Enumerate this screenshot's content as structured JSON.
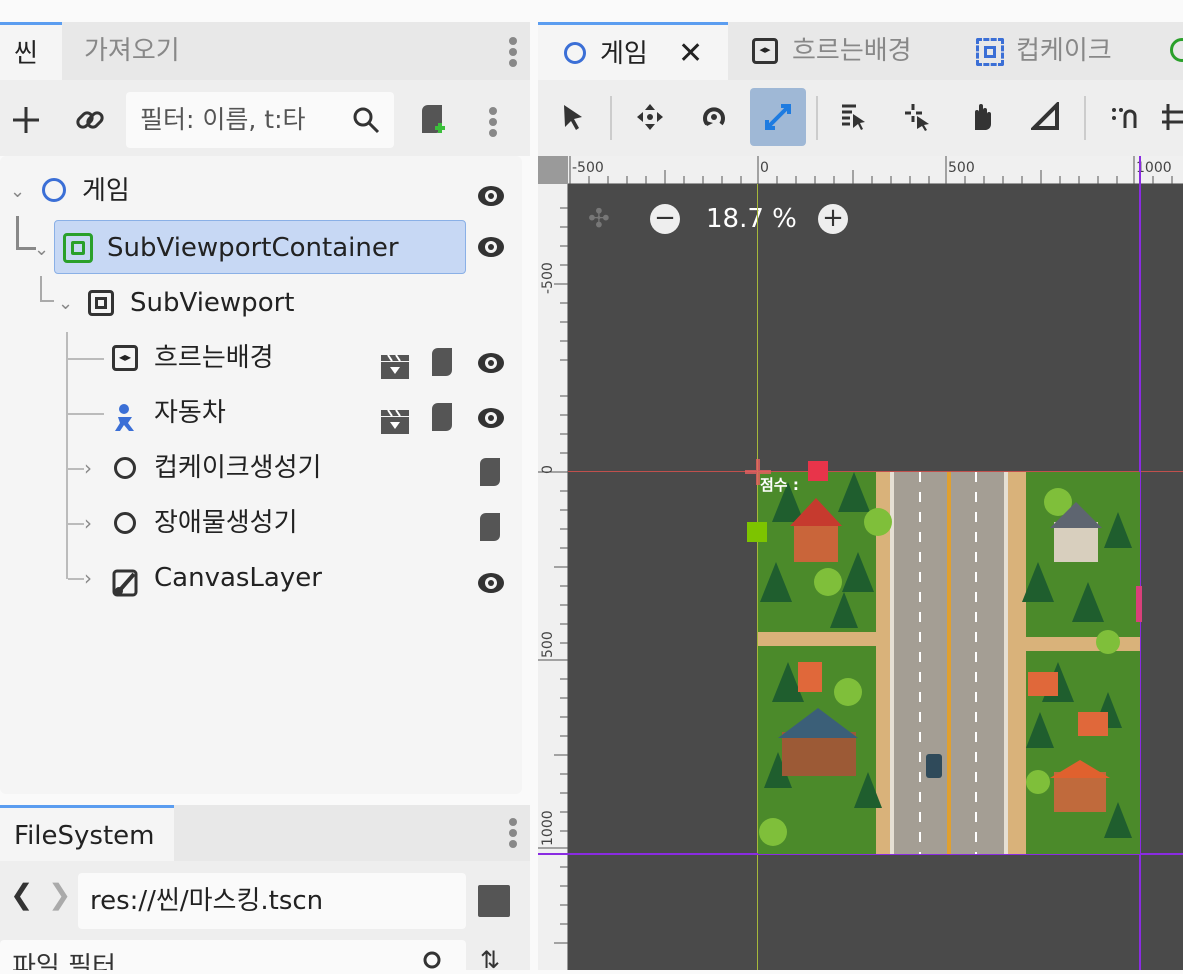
{
  "scene_dock": {
    "tabs": [
      "씬",
      "가져오기"
    ],
    "filter_placeholder": "필터: 이름, t:타",
    "tree": [
      {
        "label": "게임",
        "icon": "node-circle-icon",
        "visible": true
      },
      {
        "label": "SubViewportContainer",
        "icon": "subviewport-container-icon",
        "visible": true,
        "selected": true
      },
      {
        "label": "SubViewport",
        "icon": "subviewport-icon"
      },
      {
        "label": "흐르는배경",
        "icon": "parallax-icon",
        "visible": true,
        "script": true,
        "clapper": true
      },
      {
        "label": "자동차",
        "icon": "character-body-icon",
        "visible": true,
        "script": true,
        "clapper": true
      },
      {
        "label": "컵케이크생성기",
        "icon": "node-circle-icon",
        "script": true
      },
      {
        "label": "장애물생성기",
        "icon": "node-circle-icon",
        "script": true
      },
      {
        "label": "CanvasLayer",
        "icon": "canvas-layer-icon",
        "visible": true
      }
    ]
  },
  "filesystem": {
    "tab": "FileSystem",
    "path": "res://씬/마스킹.tscn",
    "file_filter": "파일 필터"
  },
  "editor": {
    "tabs": [
      "게임",
      "흐르는배경",
      "컵케이크"
    ],
    "zoom": "18.7 %",
    "ruler_h": [
      "-500",
      "0",
      "500",
      "1000"
    ],
    "ruler_v": [
      "-500",
      "0",
      "500",
      "1000"
    ],
    "origin_label": "점수 :"
  },
  "colors": {
    "accent": "#5b9df0",
    "selection": "#c7d8f4",
    "guide_purple": "#8a2be2",
    "viewport_bg": "#4a4a4a"
  }
}
